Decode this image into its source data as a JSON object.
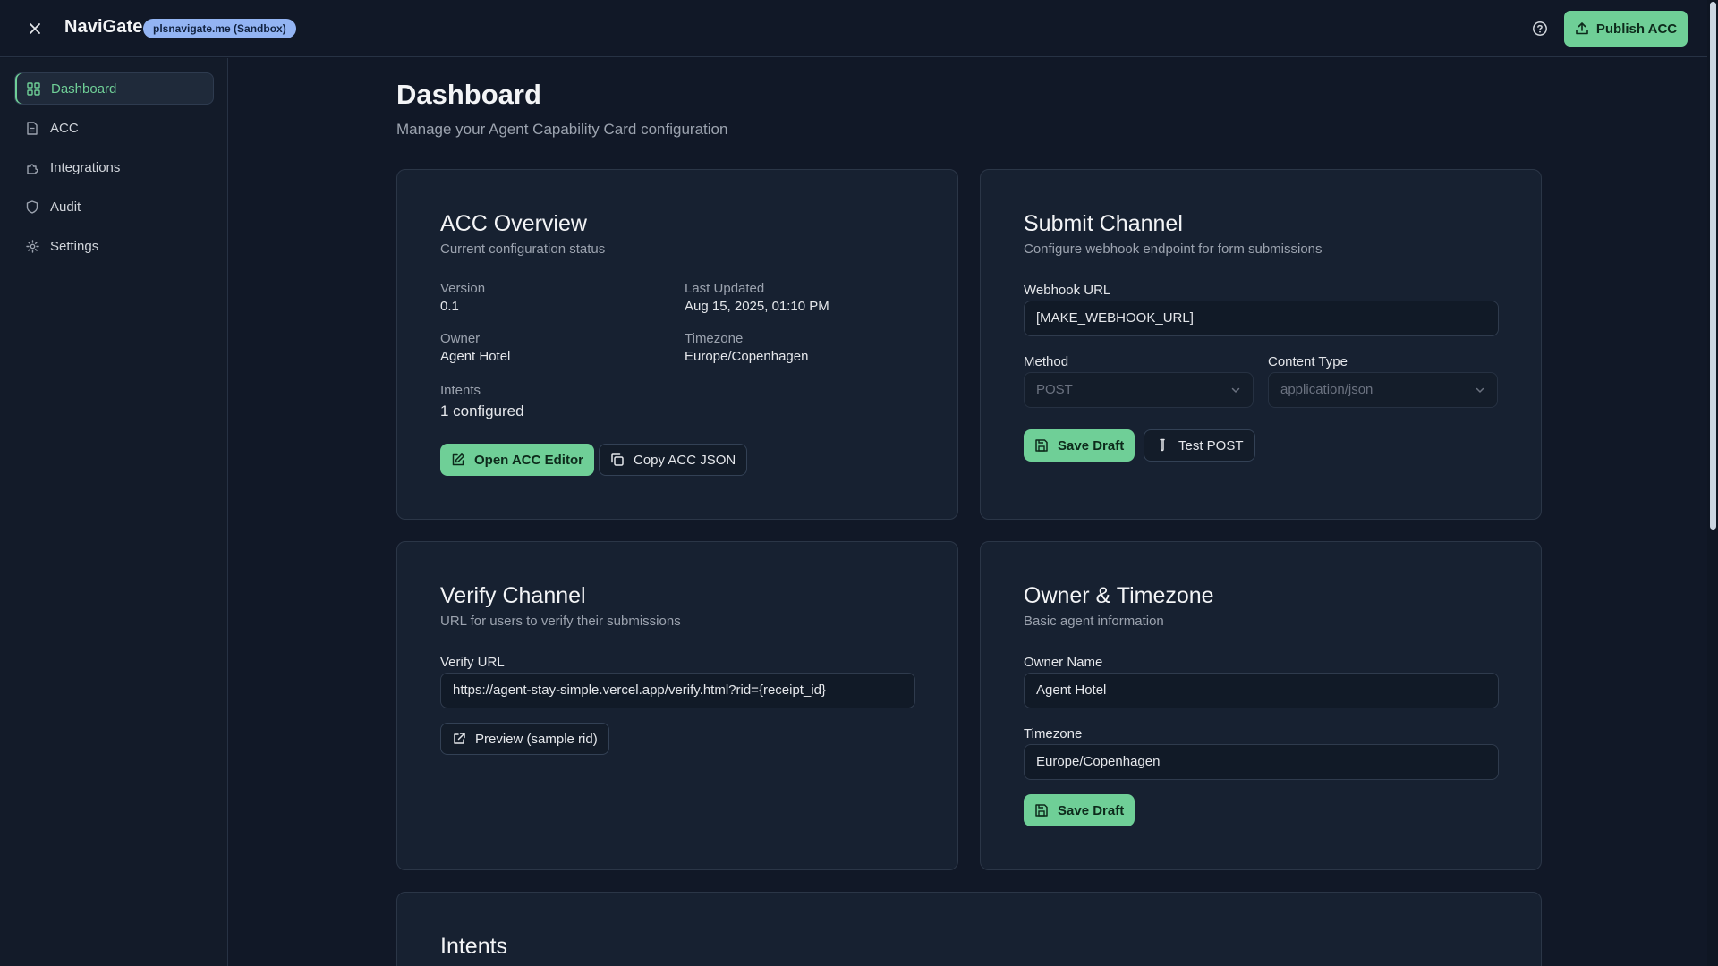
{
  "header": {
    "app_name": "NaviGate",
    "env_badge": "plsnavigate.me (Sandbox)",
    "publish_label": "Publish ACC"
  },
  "sidebar": {
    "items": [
      {
        "label": "Dashboard",
        "icon": "dashboard-icon",
        "active": true
      },
      {
        "label": "ACC",
        "icon": "document-icon"
      },
      {
        "label": "Integrations",
        "icon": "puzzle-icon"
      },
      {
        "label": "Audit",
        "icon": "shield-icon"
      },
      {
        "label": "Settings",
        "icon": "gear-icon"
      }
    ]
  },
  "page": {
    "title": "Dashboard",
    "subtitle": "Manage your Agent Capability Card configuration"
  },
  "overview": {
    "title": "ACC Overview",
    "desc": "Current configuration status",
    "version_label": "Version",
    "version": "0.1",
    "updated_label": "Last Updated",
    "updated": "Aug 15, 2025, 01:10 PM",
    "owner_label": "Owner",
    "owner": "Agent Hotel",
    "timezone_label": "Timezone",
    "timezone": "Europe/Copenhagen",
    "intents_label": "Intents",
    "intents": "1 configured",
    "open_editor_label": "Open ACC Editor",
    "copy_json_label": "Copy ACC JSON"
  },
  "submit": {
    "title": "Submit Channel",
    "desc": "Configure webhook endpoint for form submissions",
    "webhook_label": "Webhook URL",
    "webhook_value": "[MAKE_WEBHOOK_URL]",
    "method_label": "Method",
    "method_value": "POST",
    "content_type_label": "Content Type",
    "content_type_value": "application/json",
    "save_label": "Save Draft",
    "test_label": "Test POST"
  },
  "verify": {
    "title": "Verify Channel",
    "desc": "URL for users to verify their submissions",
    "url_label": "Verify URL",
    "url_value": "https://agent-stay-simple.vercel.app/verify.html?rid={receipt_id}",
    "preview_label": "Preview (sample rid)"
  },
  "owner_tz": {
    "title": "Owner & Timezone",
    "desc": "Basic agent information",
    "owner_label": "Owner Name",
    "owner_value": "Agent Hotel",
    "tz_label": "Timezone",
    "tz_value": "Europe/Copenhagen",
    "save_label": "Save Draft"
  },
  "intents_card": {
    "title": "Intents"
  },
  "colors": {
    "background": "#111827",
    "accent": "#6fcf97",
    "badge": "#93b4f3"
  }
}
